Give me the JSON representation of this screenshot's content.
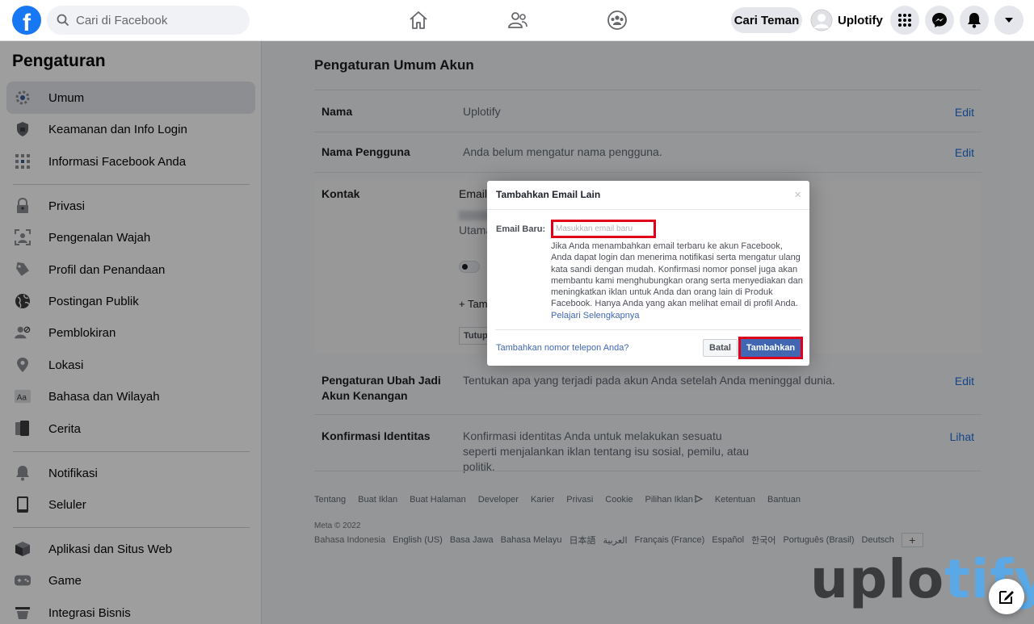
{
  "topbar": {
    "logo": "f",
    "search_placeholder": "Cari di Facebook",
    "find_friends": "Cari Teman",
    "user_name": "Uplotify"
  },
  "sidebar": {
    "title": "Pengaturan",
    "items": [
      {
        "label": "Umum",
        "icon": "gear-icon"
      },
      {
        "label": "Keamanan dan Info Login",
        "icon": "shield-icon"
      },
      {
        "label": "Informasi Facebook Anda",
        "icon": "grid-icon"
      },
      {
        "label": "Privasi",
        "icon": "lock-icon"
      },
      {
        "label": "Pengenalan Wajah",
        "icon": "face-icon"
      },
      {
        "label": "Profil dan Penandaan",
        "icon": "tag-icon"
      },
      {
        "label": "Postingan Publik",
        "icon": "globe-icon"
      },
      {
        "label": "Pemblokiran",
        "icon": "block-user-icon"
      },
      {
        "label": "Lokasi",
        "icon": "location-icon"
      },
      {
        "label": "Bahasa dan Wilayah",
        "icon": "language-icon"
      },
      {
        "label": "Cerita",
        "icon": "story-icon"
      },
      {
        "label": "Notifikasi",
        "icon": "bell-icon"
      },
      {
        "label": "Seluler",
        "icon": "phone-icon"
      },
      {
        "label": "Aplikasi dan Situs Web",
        "icon": "box-icon"
      },
      {
        "label": "Game",
        "icon": "gamepad-icon"
      },
      {
        "label": "Integrasi Bisnis",
        "icon": "business-icon"
      }
    ]
  },
  "main": {
    "title": "Pengaturan Umum Akun",
    "rows": [
      {
        "label": "Nama",
        "value": "Uplotify",
        "action": "Edit"
      },
      {
        "label": "Nama Pengguna",
        "value": "Anda belum mengatur nama pengguna.",
        "action": "Edit"
      },
      {
        "label": "Kontak",
        "value": "Email",
        "partial_primary": "Utama",
        "partial_add": "+ Tam",
        "partial_close": "Tutup"
      },
      {
        "label": "Pengaturan Ubah Jadi Akun Kenangan",
        "value": "Tentukan apa yang terjadi pada akun Anda setelah Anda meninggal dunia.",
        "action": "Edit"
      },
      {
        "label": "Konfirmasi Identitas",
        "value": "Konfirmasi identitas Anda untuk melakukan sesuatu seperti menjalankan iklan tentang isu sosial, pemilu, atau politik.",
        "action": "Lihat"
      }
    ]
  },
  "footer": {
    "links": [
      "Tentang",
      "Buat Iklan",
      "Buat Halaman",
      "Developer",
      "Karier",
      "Privasi",
      "Cookie",
      "Pilihan Iklan",
      "Ketentuan",
      "Bantuan"
    ],
    "copyright": "Meta © 2022",
    "current_language": "Bahasa Indonesia",
    "languages": [
      "English (US)",
      "Basa Jawa",
      "Bahasa Melayu",
      "日本語",
      "العربية",
      "Français (France)",
      "Español",
      "한국어",
      "Português (Brasil)",
      "Deutsch"
    ],
    "more": "+"
  },
  "dialog": {
    "title": "Tambahkan Email Lain",
    "close": "×",
    "email_label": "Email Baru:",
    "email_placeholder": "Masukkan email baru",
    "description": "Jika Anda menambahkan email terbaru ke akun Facebook, Anda dapat login dan menerima notifikasi serta mengatur ulang kata sandi dengan mudah. Konfirmasi nomor ponsel juga akan membantu kami menghubungkan orang serta menyediakan dan meningkatkan iklan untuk Anda dan orang lain di Produk Facebook. Hanya Anda yang akan melihat email di profil Anda.",
    "learn_more": "Pelajari Selengkapnya",
    "add_phone": "Tambahkan nomor telepon Anda?",
    "cancel": "Batal",
    "submit": "Tambahkan"
  },
  "watermark": {
    "part1": "uplo",
    "part2": "tify"
  },
  "colors": {
    "fb_blue": "#1877f2",
    "highlight_red": "#e0001a",
    "button_blue": "#4267b2"
  }
}
